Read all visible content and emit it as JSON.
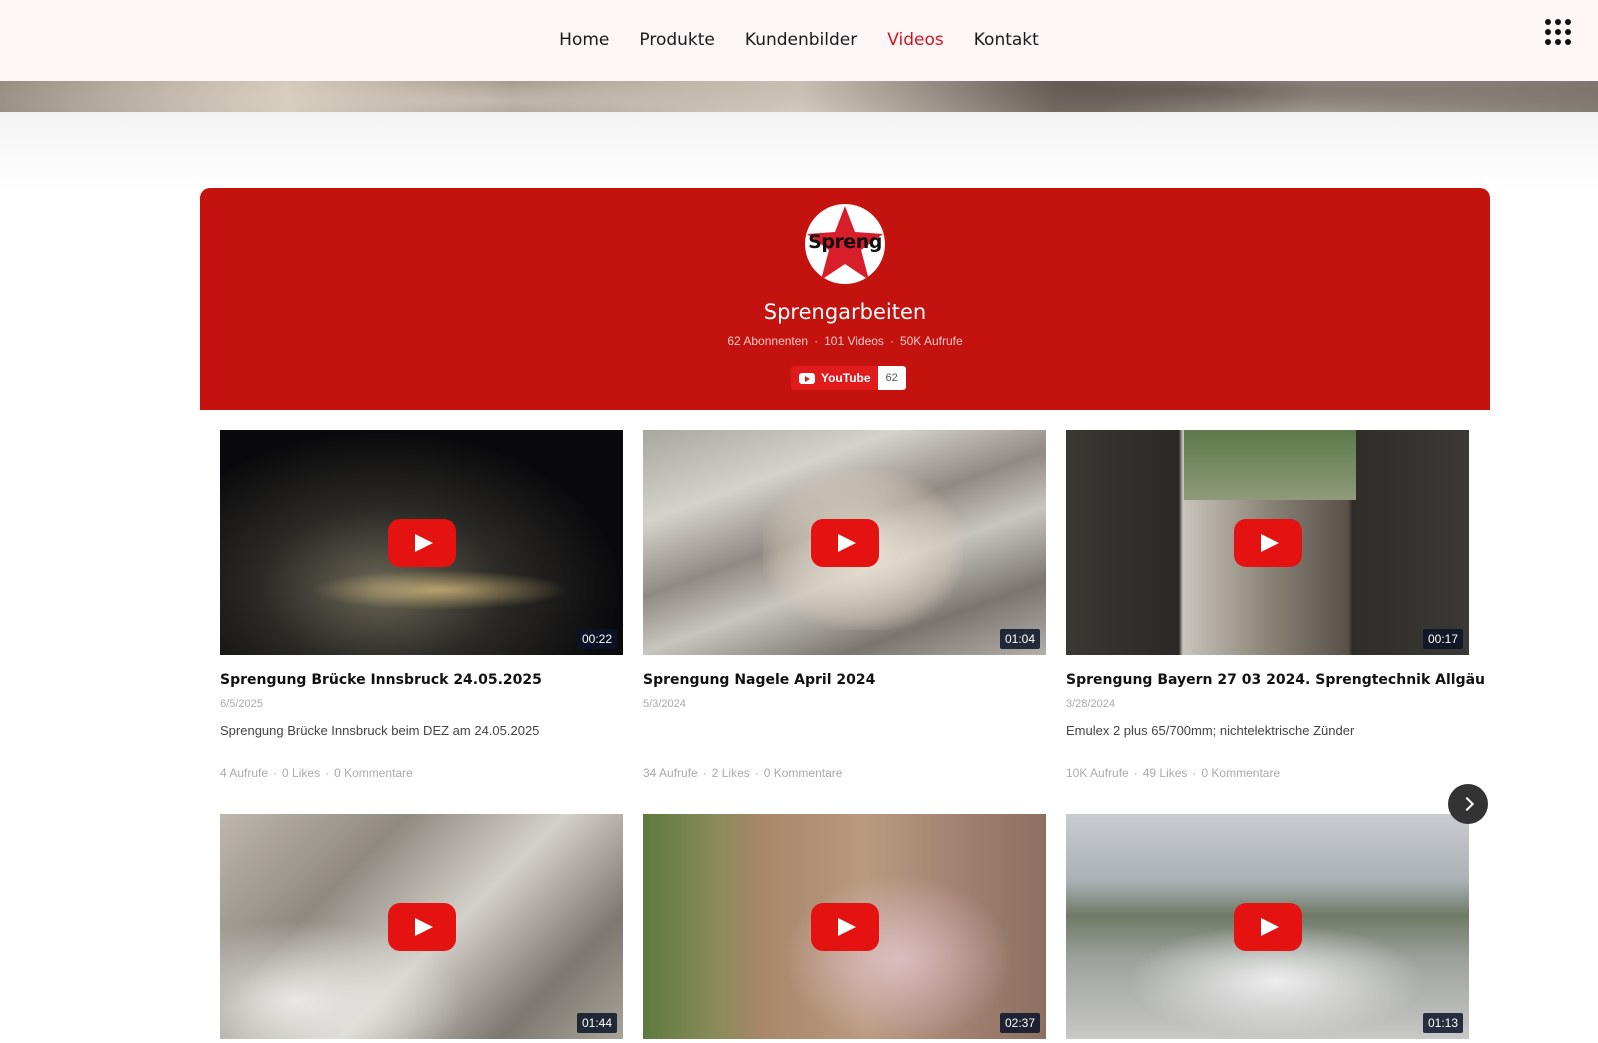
{
  "nav": {
    "items": [
      "Home",
      "Produkte",
      "Kundenbilder",
      "Videos",
      "Kontakt"
    ],
    "active": "Videos"
  },
  "channel": {
    "logo_text": "Spreng",
    "name": "Sprengarbeiten",
    "subscribers": "62 Abonnenten",
    "videos": "101 Videos",
    "views": "50K Aufrufe",
    "separator": "·",
    "youtube_label": "YouTube",
    "youtube_count": "62",
    "accent_color": "#c4120e"
  },
  "videos": [
    {
      "title": "Sprengung Brücke Innsbruck 24.05.2025",
      "date": "6/5/2025",
      "description": "Sprengung Brücke Innsbruck beim DEZ am 24.05.2025",
      "duration": "00:22",
      "views": "4 Aufrufe",
      "likes": "0 Likes",
      "comments": "0 Kommentare"
    },
    {
      "title": "Sprengung Nagele April 2024",
      "date": "5/3/2024",
      "description": "",
      "duration": "01:04",
      "views": "34 Aufrufe",
      "likes": "2 Likes",
      "comments": "0 Kommentare"
    },
    {
      "title": "Sprengung Bayern 27 03 2024. Sprengtechnik Allgäu",
      "date": "3/28/2024",
      "description": "Emulex 2 plus 65/700mm; nichtelektrische Zünder",
      "duration": "00:17",
      "views": "10K Aufrufe",
      "likes": "49 Likes",
      "comments": "0 Kommentare"
    },
    {
      "duration": "01:44"
    },
    {
      "duration": "02:37"
    },
    {
      "duration": "01:13"
    }
  ],
  "icons": {
    "menu": "grid-menu-icon",
    "play": "play-icon",
    "next": "chevron-right-icon",
    "youtube": "youtube-icon"
  }
}
